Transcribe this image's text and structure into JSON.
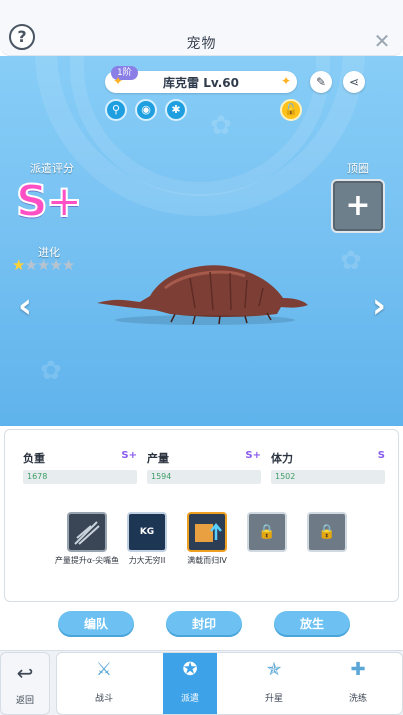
{
  "header": {
    "title": "宠物",
    "help_icon": "question-icon",
    "close_icon": "close-icon"
  },
  "pet": {
    "tier": "1阶",
    "name": "库克雷 Lv.60",
    "attributes": [
      "wind-sword-icon",
      "water-icon",
      "bug-icon"
    ],
    "lock_icon": "lock-open-icon"
  },
  "dispatch": {
    "label": "派遣评分",
    "grade": "S+"
  },
  "crown": {
    "label": "顶圈"
  },
  "evolution": {
    "label": "进化",
    "stars_filled": 1,
    "stars_total": 5
  },
  "stats": [
    {
      "label": "负重",
      "value": "1678",
      "grade": "S+"
    },
    {
      "label": "产量",
      "value": "1594",
      "grade": "S+"
    },
    {
      "label": "体力",
      "value": "1502",
      "grade": "S"
    }
  ],
  "skills": [
    {
      "name": "产量提升α-尖嘴鱼",
      "icon": "fish-item-icon"
    },
    {
      "name": "力大无穷II",
      "icon": "kg-weight-icon"
    },
    {
      "name": "满载而归IV",
      "icon": "crate-upgrade-icon"
    },
    {
      "name": "",
      "icon": "lock-icon"
    },
    {
      "name": "",
      "icon": "lock-icon"
    }
  ],
  "actions": {
    "team": "编队",
    "seal": "封印",
    "release": "放生"
  },
  "nav": {
    "back": "返回",
    "tabs": [
      {
        "label": "战斗",
        "icon": "battle-icon"
      },
      {
        "label": "派遣",
        "icon": "dispatch-icon",
        "active": true
      },
      {
        "label": "升星",
        "icon": "star-up-icon"
      },
      {
        "label": "洗练",
        "icon": "refine-icon"
      }
    ]
  },
  "colors": {
    "scene_blue": "#78c2f2",
    "button_blue": "#6cc1f2",
    "active_tab": "#3da2e8",
    "grade_pink": "#ff4fc4"
  }
}
